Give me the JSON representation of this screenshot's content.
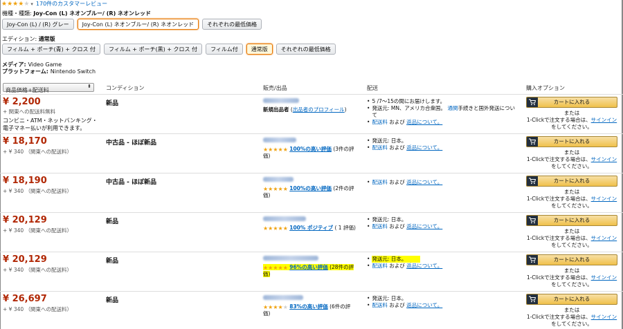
{
  "header": {
    "review_count_link": "170件のカスタマーレビュー",
    "rating_stars": 4
  },
  "variation": {
    "label": "機種・種類: ",
    "selected_value": "Joy-Con (L) ネオンブルー/ (R) ネオンレッド",
    "options": [
      "Joy-Con (L) / (R) グレー",
      "Joy-Con (L) ネオンブルー/ (R) ネオンレッド",
      "それぞれの最低価格"
    ]
  },
  "edition": {
    "label": "エディション: ",
    "selected_value": "通常版",
    "options": [
      "フィルム + ポーチ(青) + クロス 付",
      "フィルム + ポーチ(黒) + クロス 付",
      "フィルム付",
      "通常版",
      "それぞれの最低価格"
    ]
  },
  "meta": {
    "media_label": "メディア: ",
    "media_value": "Video Game",
    "platform_label": "プラットフォーム: ",
    "platform_value": "Nintendo Switch"
  },
  "table": {
    "sort_select": "商品価格+配送料",
    "columns": [
      "コンディション",
      "販売/出品",
      "配送",
      "購入オプション"
    ],
    "cart_label": "カートに入れる",
    "or_label": "または",
    "oneclick_prefix": "1-Clickで注文する場合は、",
    "signin_link": "サインイン",
    "oneclick_suffix": "をしてください。",
    "rows": [
      {
        "price": "¥ 2,200",
        "shipping": "+ 関東への配送料無料",
        "note": "コンビニ・ATM・ネットバンキング・電子マネー払いが利用できます。",
        "condition": "新品",
        "seller_tag": "新規出品者",
        "seller_profile_open": " (",
        "seller_profile_link": "出品者のプロフィール",
        "seller_profile_close": ")",
        "delivery": [
          "5 /7〜15の間にお届けします。",
          "発送元: MN、アメリカ合衆国。",
          "通関",
          "手続きと国外発送について"
        ],
        "delivery_fee_link": "配送料",
        "delivery_and": "および",
        "returns_link": "返品について。"
      },
      {
        "price": "¥ 18,170",
        "shipping_prefix": "+ ¥ 340 （",
        "shipping_link": "関東への配送料",
        "shipping_suffix": "）",
        "condition": "中古品 - ほぼ新品",
        "rating_link": "100%の高い評価",
        "rating_count": "(3件の評価)",
        "delivery_origin": "発送元: 日本。",
        "delivery_fee_link": "配送料",
        "delivery_and": "および",
        "returns_link": "返品について。"
      },
      {
        "price": "¥ 18,190",
        "shipping_prefix": "+ ¥ 340 （",
        "shipping_link": "関東への配送料",
        "shipping_suffix": "）",
        "condition": "中古品 - ほぼ新品",
        "rating_link": "100%の高い評価",
        "rating_count": "(2件の評価)",
        "delivery_fee_link": "配送料",
        "delivery_and": "および",
        "returns_link": "返品について。"
      },
      {
        "price": "¥ 20,129",
        "shipping_prefix": "+ ¥ 340 （",
        "shipping_link": "関東への配送料",
        "shipping_suffix": "）",
        "condition": "新品",
        "rating_link": "100% ポジティブ",
        "rating_count": "( 1 評価)",
        "delivery_origin": "発送元: 日本。",
        "delivery_fee_link": "配送料",
        "delivery_and": "および",
        "returns_link": "返品について。"
      },
      {
        "price": "¥ 20,129",
        "shipping_prefix": "+ ¥ 340 （",
        "shipping_link": "関東への配送料",
        "shipping_suffix": "）",
        "condition": "新品",
        "rating_link": "96%の高い評価",
        "rating_count": "(28件の評価)",
        "delivery_origin": "発送元: 日本。",
        "delivery_fee_link": "配送料",
        "delivery_and": "および",
        "returns_link": "返品について。"
      },
      {
        "price": "¥ 26,697",
        "shipping_prefix": "+ ¥ 340 （",
        "shipping_link": "関東への配送料",
        "shipping_suffix": "）",
        "condition": "新品",
        "rating_link": "83%の高い評価",
        "rating_count": "(6件の評価)",
        "delivery_origin": "発送元: 日本。",
        "delivery_fee_link": "配送料",
        "delivery_and": "および",
        "returns_link": "返品について。"
      }
    ]
  },
  "colors": {
    "price": "#b12704",
    "link": "#0066c0",
    "star": "#f0a20f",
    "highlight": "#ffff00",
    "cart_button": "#f0c14b"
  }
}
